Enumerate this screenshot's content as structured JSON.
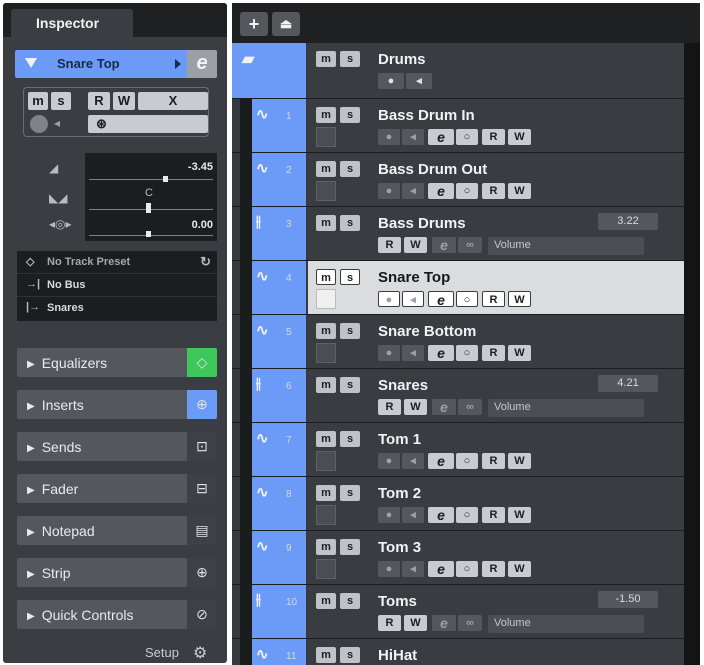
{
  "inspector": {
    "tab_label": "Inspector",
    "track_name": "Snare Top",
    "edit_glyph": "e",
    "buttons": {
      "mute": "m",
      "solo": "s",
      "read": "R",
      "write": "W",
      "freeze": "X"
    },
    "fader": {
      "volume": "-3.45",
      "pan": "C",
      "delay": "0.00"
    },
    "routing": {
      "preset": "No Track Preset",
      "bus": "No Bus",
      "channel": "Snares"
    },
    "sections": [
      {
        "label": "Equalizers",
        "icon": "eq-icon",
        "glyph": "◇",
        "color": "#3ec75a"
      },
      {
        "label": "Inserts",
        "icon": "inserts-icon",
        "glyph": "⊕",
        "color": "#6b9bf7"
      },
      {
        "label": "Sends",
        "icon": "sends-icon",
        "glyph": "⊡"
      },
      {
        "label": "Fader",
        "icon": "fader-icon",
        "glyph": "⊟"
      },
      {
        "label": "Notepad",
        "icon": "notepad-icon",
        "glyph": "▤"
      },
      {
        "label": "Strip",
        "icon": "strip-icon",
        "glyph": "⊕"
      },
      {
        "label": "Quick Controls",
        "icon": "quick-controls-icon",
        "glyph": "⊘"
      }
    ],
    "setup_label": "Setup"
  },
  "tracklist": {
    "toolbar": {
      "add_glyph": "+",
      "folder_glyph": "⏏"
    },
    "tracks": [
      {
        "number": "",
        "name": "Drums",
        "kind": "folder"
      },
      {
        "number": "1",
        "name": "Bass Drum In",
        "kind": "audio"
      },
      {
        "number": "2",
        "name": "Bass Drum Out",
        "kind": "audio"
      },
      {
        "number": "3",
        "name": "Bass Drums",
        "kind": "group",
        "value": "3.22",
        "automation": "Volume"
      },
      {
        "number": "4",
        "name": "Snare Top",
        "kind": "audio",
        "selected": true
      },
      {
        "number": "5",
        "name": "Snare Bottom",
        "kind": "audio"
      },
      {
        "number": "6",
        "name": "Snares",
        "kind": "group",
        "value": "4.21",
        "automation": "Volume"
      },
      {
        "number": "7",
        "name": "Tom 1",
        "kind": "audio"
      },
      {
        "number": "8",
        "name": "Tom 2",
        "kind": "audio"
      },
      {
        "number": "9",
        "name": "Tom 3",
        "kind": "audio"
      },
      {
        "number": "10",
        "name": "Toms",
        "kind": "group",
        "value": "-1.50",
        "automation": "Volume"
      },
      {
        "number": "11",
        "name": "HiHat",
        "kind": "audio"
      }
    ],
    "labels": {
      "mute": "m",
      "solo": "s",
      "read": "R",
      "write": "W"
    }
  },
  "colors": {
    "track_blue": "#6b9bf7",
    "eq_green": "#3ec75a",
    "panel": "#3a3d41"
  }
}
